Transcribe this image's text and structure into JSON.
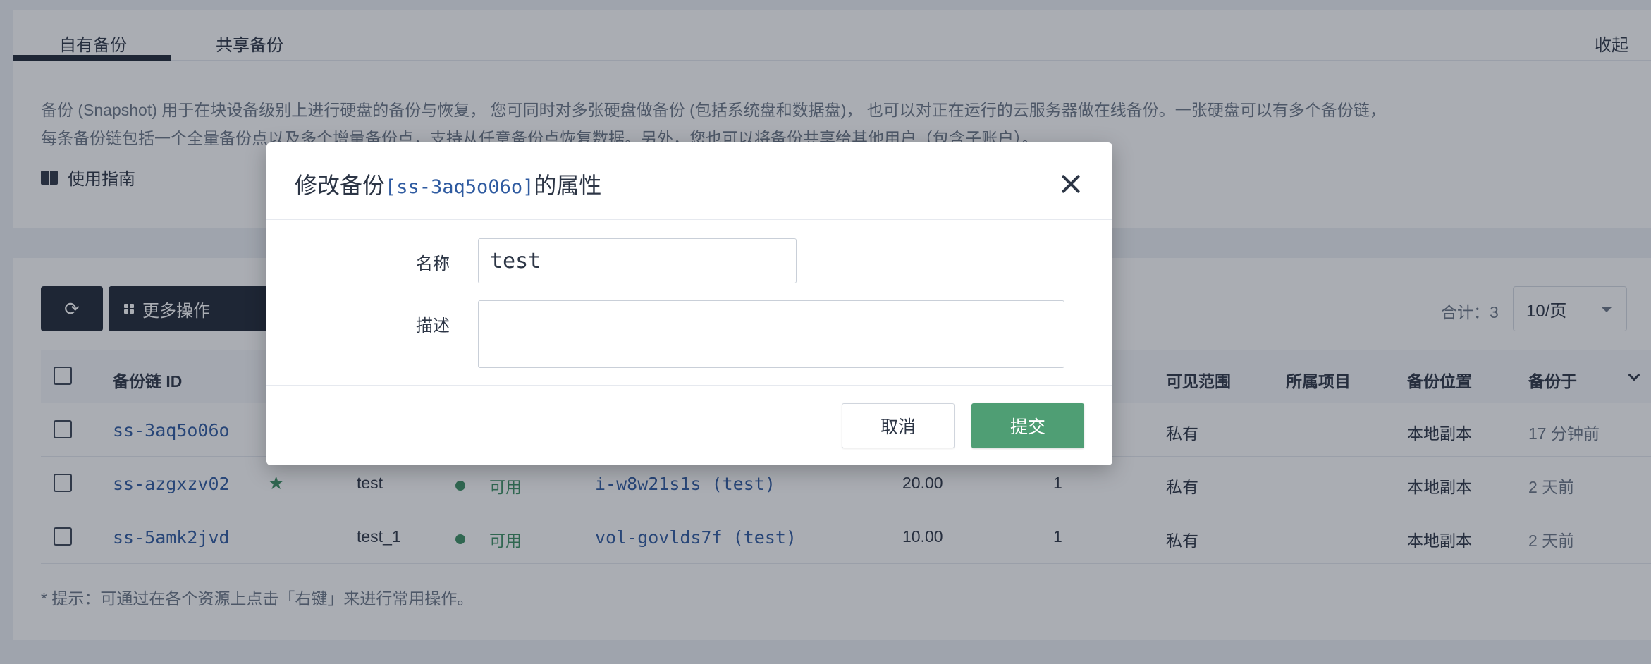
{
  "tabs": [
    "自有备份",
    "共享备份"
  ],
  "collapse_label": "收起",
  "description": "备份 (Snapshot) 用于在块设备级别上进行硬盘的备份与恢复， 您可同时对多张硬盘做备份 (包括系统盘和数据盘)， 也可以对正在运行的云服务器做在线备份。一张硬盘可以有多个备份链，每条备份链包括一个全量备份点以及多个增量备份点，支持从任意备份点恢复数据。另外，您也可以将备份共享给其他用户（包含子账户）。",
  "guide_label": "使用指南",
  "toolbar": {
    "more_actions_label": "更多操作",
    "total_label": "合计：3",
    "page_size": "10/页"
  },
  "table": {
    "headers": [
      "备份链 ID",
      "可见范围",
      "所属项目",
      "备份位置",
      "备份于"
    ],
    "rows": [
      {
        "id": "ss-3aq5o06o",
        "starred": true,
        "name": "",
        "status": "",
        "resource": "",
        "size": "",
        "count": "",
        "scope": "私有",
        "project": "",
        "location": "本地副本",
        "time": "17 分钟前"
      },
      {
        "id": "ss-azgxzv02",
        "starred": true,
        "name": "test",
        "status": "可用",
        "resource": "i-w8w21s1s (test)",
        "size": "20.00",
        "count": "1",
        "scope": "私有",
        "project": "",
        "location": "本地副本",
        "time": "2 天前"
      },
      {
        "id": "ss-5amk2jvd",
        "starred": false,
        "name": "test_1",
        "status": "可用",
        "resource": "vol-govlds7f (test)",
        "size": "10.00",
        "count": "1",
        "scope": "私有",
        "project": "",
        "location": "本地副本",
        "time": "2 天前"
      }
    ]
  },
  "hint": "* 提示：可通过在各个资源上点击「右键」来进行常用操作。",
  "modal": {
    "title_prefix": "修改备份",
    "title_resource": "[ss-3aq5o06o]",
    "title_suffix": "的属性",
    "name_label": "名称",
    "name_value": "test",
    "desc_label": "描述",
    "desc_value": "",
    "cancel_label": "取消",
    "submit_label": "提交"
  },
  "colors": {
    "dark": "#1d2635",
    "link": "#2e5aa0",
    "green": "#3a8f62",
    "submit": "#4f9e74"
  }
}
